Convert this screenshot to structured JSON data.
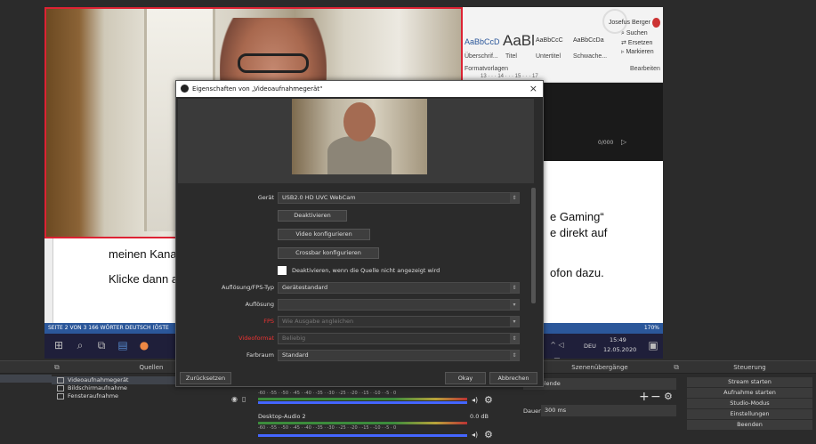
{
  "word": {
    "ribbon": {
      "user": "Josefus Berger",
      "styles": [
        "AaBbCcD",
        "AaBl",
        "AaBbCcC",
        "AaBbCcDa"
      ],
      "style_names": [
        "Überschrif...",
        "Titel",
        "Untertitel",
        "Schwache..."
      ],
      "group_label": "Formatvorlagen",
      "edit_items": [
        "Suchen",
        "Ersetzen",
        "Markieren"
      ],
      "edit_group": "Bearbeiten",
      "ruler": "13 · · · 14 · · · 15 · · · 17"
    },
    "lines": [
      "meinen Kanal",
      "Klicke dann a"
    ],
    "right_lines": [
      "e Gaming“",
      "e direkt auf",
      "ofon dazu."
    ],
    "video_time": "0/000",
    "statusbar": "SEITE 2 VON 3   166 WÖRTER   DEUTSCH (ÖSTE",
    "zoom": "170%"
  },
  "taskbar": {
    "lang": "DEU",
    "time": "15:49",
    "date": "12.05.2020"
  },
  "dialog": {
    "title": "Eigenschaften von „Videoaufnahmegerät“",
    "close": "×",
    "device_label": "Gerät",
    "device_value": "USB2.0 HD UVC WebCam",
    "btn_deactivate": "Deaktivieren",
    "btn_configure_video": "Video konfigurieren",
    "btn_configure_crossbar": "Crossbar konfigurieren",
    "checkbox_label": "Deaktivieren, wenn die Quelle nicht angezeigt wird",
    "resolution_type_label": "Auflösung/FPS-Typ",
    "resolution_type_value": "Gerätestandard",
    "resolution_label": "Auflösung",
    "resolution_value": "",
    "fps_label": "FPS",
    "fps_value": "Wie Ausgabe angleichen",
    "format_label": "Videoformat",
    "format_value": "Beliebig",
    "colorspace_label": "Farbraum",
    "colorspace_value": "Standard",
    "reset": "Zurücksetzen",
    "ok": "Okay",
    "cancel": "Abbrechen"
  },
  "sources": {
    "header": "Quellen",
    "items": [
      "Videoaufnahmegerät",
      "Bildschirmaufnahme",
      "Fensteraufnahme"
    ]
  },
  "mixer": {
    "channel": "Desktop-Audio 2",
    "level": "0.0 dB"
  },
  "transitions": {
    "header": "Szenenübergänge",
    "selected": "Überblende",
    "duration_label": "Dauer",
    "duration_value": "300 ms"
  },
  "controls": {
    "header": "Steuerung",
    "buttons": [
      "Stream starten",
      "Aufnahme starten",
      "Studio-Modus",
      "Einstellungen",
      "Beenden"
    ]
  }
}
